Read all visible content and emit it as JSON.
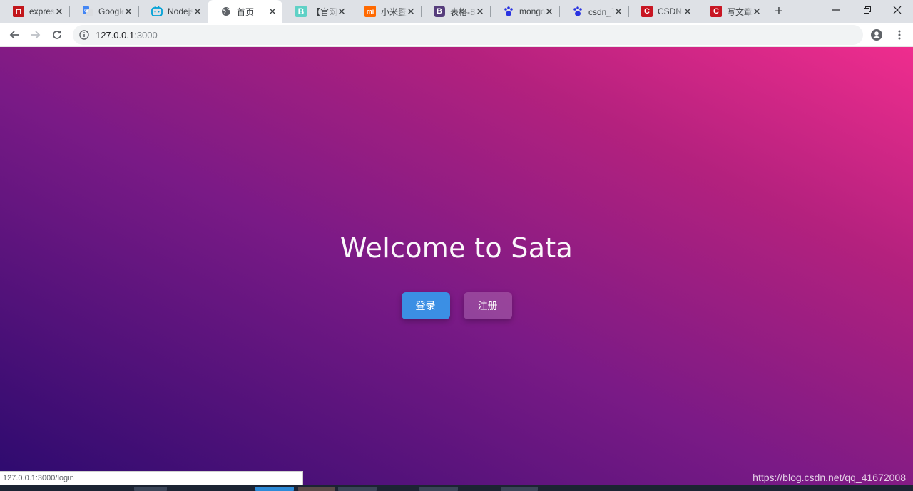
{
  "browser": {
    "tabs": [
      {
        "label": "express",
        "icon": "red-square-icon",
        "color": "#c2161b"
      },
      {
        "label": "Google",
        "icon": "google-translate-icon",
        "color": "#4285f4"
      },
      {
        "label": "Nodejs",
        "icon": "bilibili-tv-icon",
        "color": "#00a1d6"
      },
      {
        "label": "首页",
        "icon": "globe-icon",
        "color": "#5f6368",
        "active": true
      },
      {
        "label": "【官网",
        "icon": "b-letter-icon",
        "color": "#5fd1c6"
      },
      {
        "label": "小米暨",
        "icon": "mi-logo-icon",
        "color": "#ff6900"
      },
      {
        "label": "表格-Bo",
        "icon": "bootstrap-icon",
        "color": "#563d7c"
      },
      {
        "label": "mongo",
        "icon": "baidu-paw-icon",
        "color": "#2932e1"
      },
      {
        "label": "csdn_百",
        "icon": "baidu-paw-icon",
        "color": "#2932e1"
      },
      {
        "label": "CSDN-",
        "icon": "csdn-c-icon",
        "color": "#c81623"
      },
      {
        "label": "写文章",
        "icon": "csdn-c-icon",
        "color": "#c81623"
      }
    ],
    "address": {
      "host": "127.0.0.1",
      "port": ":3000"
    }
  },
  "page": {
    "title": "Welcome to Sata",
    "login_label": "登录",
    "register_label": "注册"
  },
  "status_bar": {
    "url": "127.0.0.1:3000/login"
  },
  "watermark": "https://blog.csdn.net/qq_41672008",
  "colors": {
    "gradient_start": "#2b0a6e",
    "gradient_end": "#ef2d8e",
    "login_button": "#3b8fe4"
  }
}
